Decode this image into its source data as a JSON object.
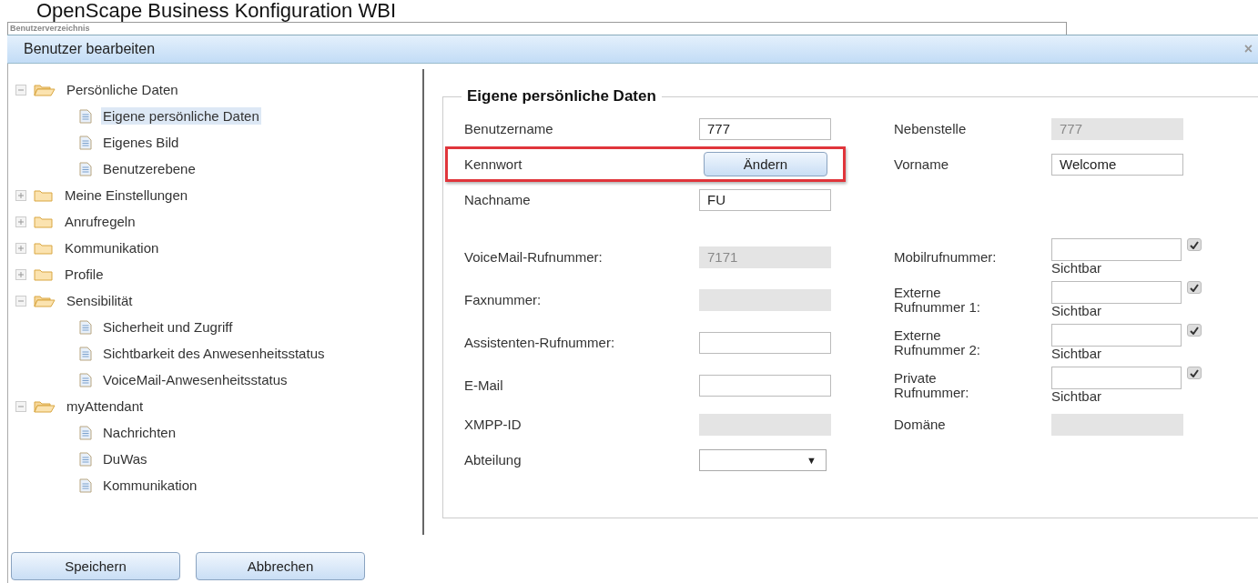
{
  "page_title": "OpenScape Business Konfiguration WBI",
  "directory": {
    "title": "Benutzerverzeichnis"
  },
  "dialog": {
    "title": "Benutzer bearbeiten",
    "close": "×"
  },
  "tree": [
    {
      "label": "Persönliche Daten",
      "expanded": true,
      "children": [
        {
          "label": "Eigene persönliche Daten",
          "selected": true
        },
        {
          "label": "Eigenes Bild",
          "selected": false
        },
        {
          "label": "Benutzerebene",
          "selected": false
        }
      ]
    },
    {
      "label": "Meine Einstellungen",
      "expanded": false
    },
    {
      "label": "Anrufregeln",
      "expanded": false
    },
    {
      "label": "Kommunikation",
      "expanded": false
    },
    {
      "label": "Profile",
      "expanded": false
    },
    {
      "label": "Sensibilität",
      "expanded": true,
      "children": [
        {
          "label": "Sicherheit und Zugriff",
          "selected": false
        },
        {
          "label": "Sichtbarkeit des Anwesenheitsstatus",
          "selected": false
        },
        {
          "label": "VoiceMail-Anwesenheitsstatus",
          "selected": false
        }
      ]
    },
    {
      "label": "myAttendant",
      "expanded": true,
      "children": [
        {
          "label": "Nachrichten",
          "selected": false
        },
        {
          "label": "DuWas",
          "selected": false
        },
        {
          "label": "Kommunikation",
          "selected": false
        }
      ]
    }
  ],
  "form": {
    "legend": "Eigene persönliche Daten",
    "sections": [
      {
        "rows": [
          {
            "left": {
              "label": "Benutzername",
              "kind": "text",
              "value": "777",
              "disabled": false
            },
            "right": {
              "label": "Nebenstelle",
              "kind": "text",
              "value": "777",
              "disabled": true
            }
          },
          {
            "highlighted": true,
            "left": {
              "label": "Kennwort",
              "kind": "button",
              "value": "Ändern"
            },
            "right": {
              "label": "Vorname",
              "kind": "text",
              "value": "Welcome",
              "disabled": false
            }
          },
          {
            "left": {
              "label": "Nachname",
              "kind": "text",
              "value": "FU",
              "disabled": false
            }
          }
        ]
      },
      {
        "rows": [
          {
            "left": {
              "label": "VoiceMail-Rufnummer:",
              "kind": "text",
              "value": "7171",
              "disabled": true
            },
            "right": {
              "label": "Mobilrufnummer:",
              "kind": "visibility",
              "checked": true,
              "caption": "Sichtbar"
            }
          },
          {
            "left": {
              "label": "Faxnummer:",
              "kind": "text",
              "disabled": true
            },
            "right": {
              "label": "Externe Rufnummer 1:",
              "kind": "visibility",
              "checked": true,
              "caption": "Sichtbar"
            }
          },
          {
            "left": {
              "label": "Assistenten-Rufnummer:",
              "kind": "text",
              "disabled": false
            },
            "right": {
              "label": "Externe Rufnummer 2:",
              "kind": "visibility",
              "checked": true,
              "caption": "Sichtbar"
            }
          },
          {
            "left": {
              "label": "E-Mail",
              "kind": "text",
              "disabled": false
            },
            "right": {
              "label": "Private Rufnummer:",
              "kind": "visibility",
              "checked": true,
              "caption": "Sichtbar"
            }
          },
          {
            "left": {
              "label": "XMPP-ID",
              "kind": "text",
              "disabled": true
            },
            "right": {
              "label": "Domäne",
              "kind": "text",
              "disabled": true
            }
          },
          {
            "left": {
              "label": "Abteilung",
              "kind": "select",
              "caret": "▼"
            }
          }
        ]
      }
    ]
  },
  "buttons": [
    "Speichern",
    "Abbrechen"
  ]
}
